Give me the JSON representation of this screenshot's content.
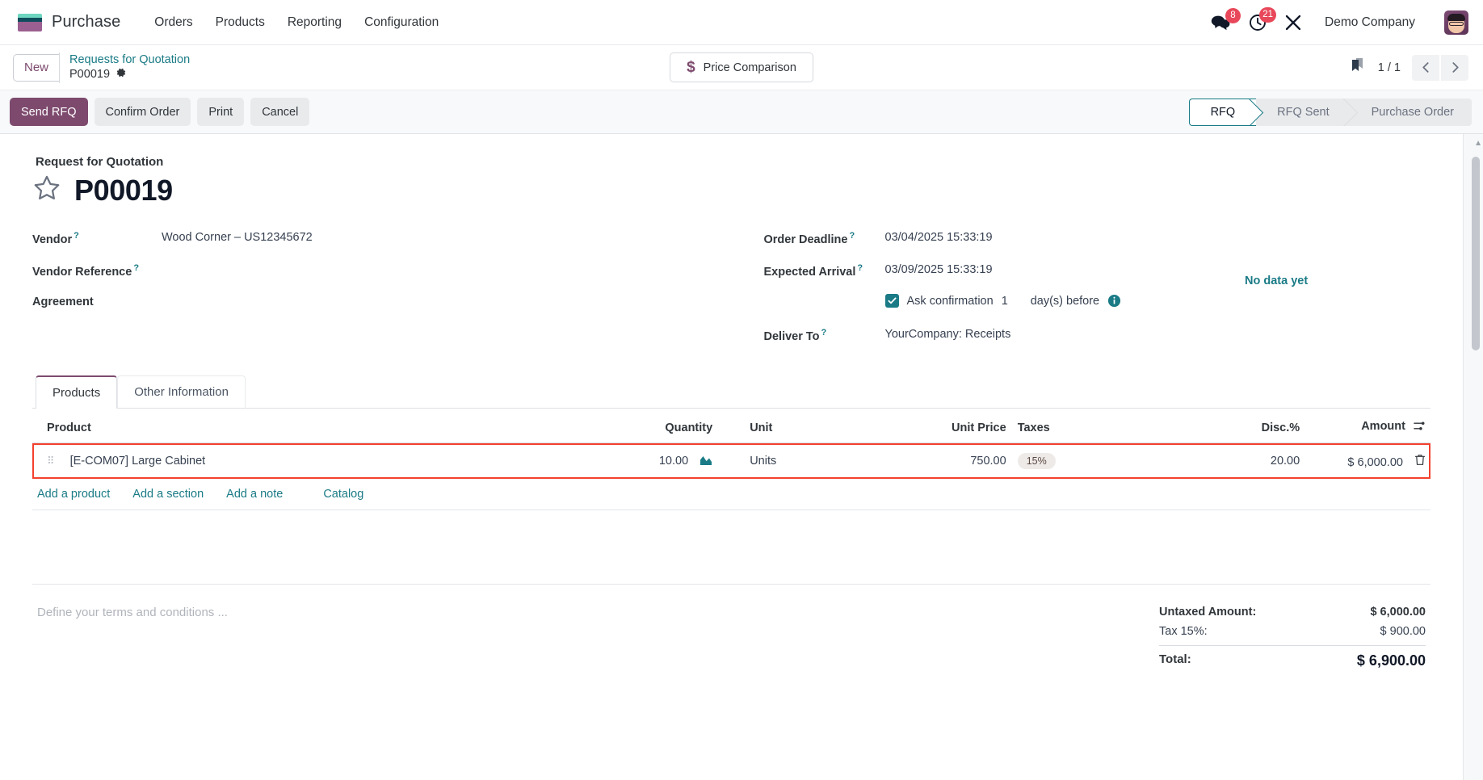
{
  "navbar": {
    "brand": "Purchase",
    "menu": [
      "Orders",
      "Products",
      "Reporting",
      "Configuration"
    ],
    "messages_badge": "8",
    "activities_badge": "21",
    "company": "Demo Company"
  },
  "controlpanel": {
    "new_label": "New",
    "breadcrumb_parent": "Requests for Quotation",
    "breadcrumb_current": "P00019",
    "price_comparison": "Price Comparison",
    "pager": "1 / 1"
  },
  "statusbar": {
    "buttons": [
      {
        "label": "Send RFQ",
        "style": "primary"
      },
      {
        "label": "Confirm Order",
        "style": "secondary"
      },
      {
        "label": "Print",
        "style": "secondary"
      },
      {
        "label": "Cancel",
        "style": "secondary"
      }
    ],
    "stages": [
      "RFQ",
      "RFQ Sent",
      "Purchase Order"
    ],
    "active_stage": "RFQ"
  },
  "form": {
    "subtitle": "Request for Quotation",
    "title": "P00019",
    "left_fields": [
      {
        "label": "Vendor",
        "help": true,
        "value": "Wood Corner – US12345672"
      },
      {
        "label": "Vendor Reference",
        "help": true,
        "value": ""
      },
      {
        "label": "Agreement",
        "help": false,
        "value": ""
      }
    ],
    "right_fields": [
      {
        "label": "Order Deadline",
        "help": true,
        "value": "03/04/2025 15:33:19"
      },
      {
        "label": "Expected Arrival",
        "help": true,
        "value": "03/09/2025 15:33:19"
      },
      {
        "label": "Deliver To",
        "help": true,
        "value": "YourCompany: Receipts"
      }
    ],
    "no_data": "No data yet",
    "ask_confirmation": {
      "checked": true,
      "label": "Ask confirmation",
      "days": "1",
      "suffix": "day(s) before"
    }
  },
  "notebook": {
    "tabs": [
      {
        "label": "Products",
        "active": true
      },
      {
        "label": "Other Information",
        "active": false
      }
    ]
  },
  "lines": {
    "headers": [
      "Product",
      "Quantity",
      "Unit",
      "Unit Price",
      "Taxes",
      "Disc.%",
      "Amount"
    ],
    "rows": [
      {
        "product": "[E-COM07] Large Cabinet",
        "quantity": "10.00",
        "unit": "Units",
        "unit_price": "750.00",
        "taxes": "15%",
        "discount": "20.00",
        "amount": "$ 6,000.00"
      }
    ],
    "add_links": [
      "Add a product",
      "Add a section",
      "Add a note"
    ],
    "catalog_link": "Catalog",
    "highlight_color": "#f4412f"
  },
  "footer": {
    "terms_placeholder": "Define your terms and conditions ...",
    "totals": [
      {
        "label": "Untaxed Amount:",
        "value": "$ 6,000.00",
        "kind": "untaxed"
      },
      {
        "label": "Tax 15%:",
        "value": "$ 900.00",
        "kind": "tax"
      },
      {
        "label": "Total:",
        "value": "$ 6,900.00",
        "kind": "total"
      }
    ]
  }
}
